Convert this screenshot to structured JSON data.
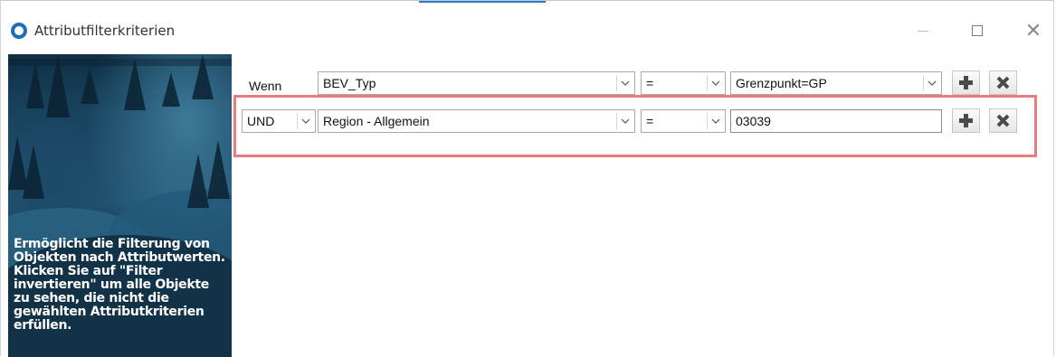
{
  "window": {
    "title": "Attributfilterkriterien"
  },
  "sidebar": {
    "description": "Ermöglicht die Filterung von Objekten nach Attributwerten. Klicken Sie auf \"Filter invertieren\" um alle Objekte zu sehen, die nicht die gewählten Attributkriterien erfüllen."
  },
  "rows": [
    {
      "prefix": "Wenn",
      "attribute": "BEV_Typ",
      "operator": "=",
      "value": "Grenzpunkt=GP"
    },
    {
      "prefix": "UND",
      "attribute": "Region - Allgemein",
      "operator": "=",
      "value": "03039"
    }
  ],
  "colors": {
    "highlight": "#e57c80",
    "accent": "#2b78d0"
  }
}
